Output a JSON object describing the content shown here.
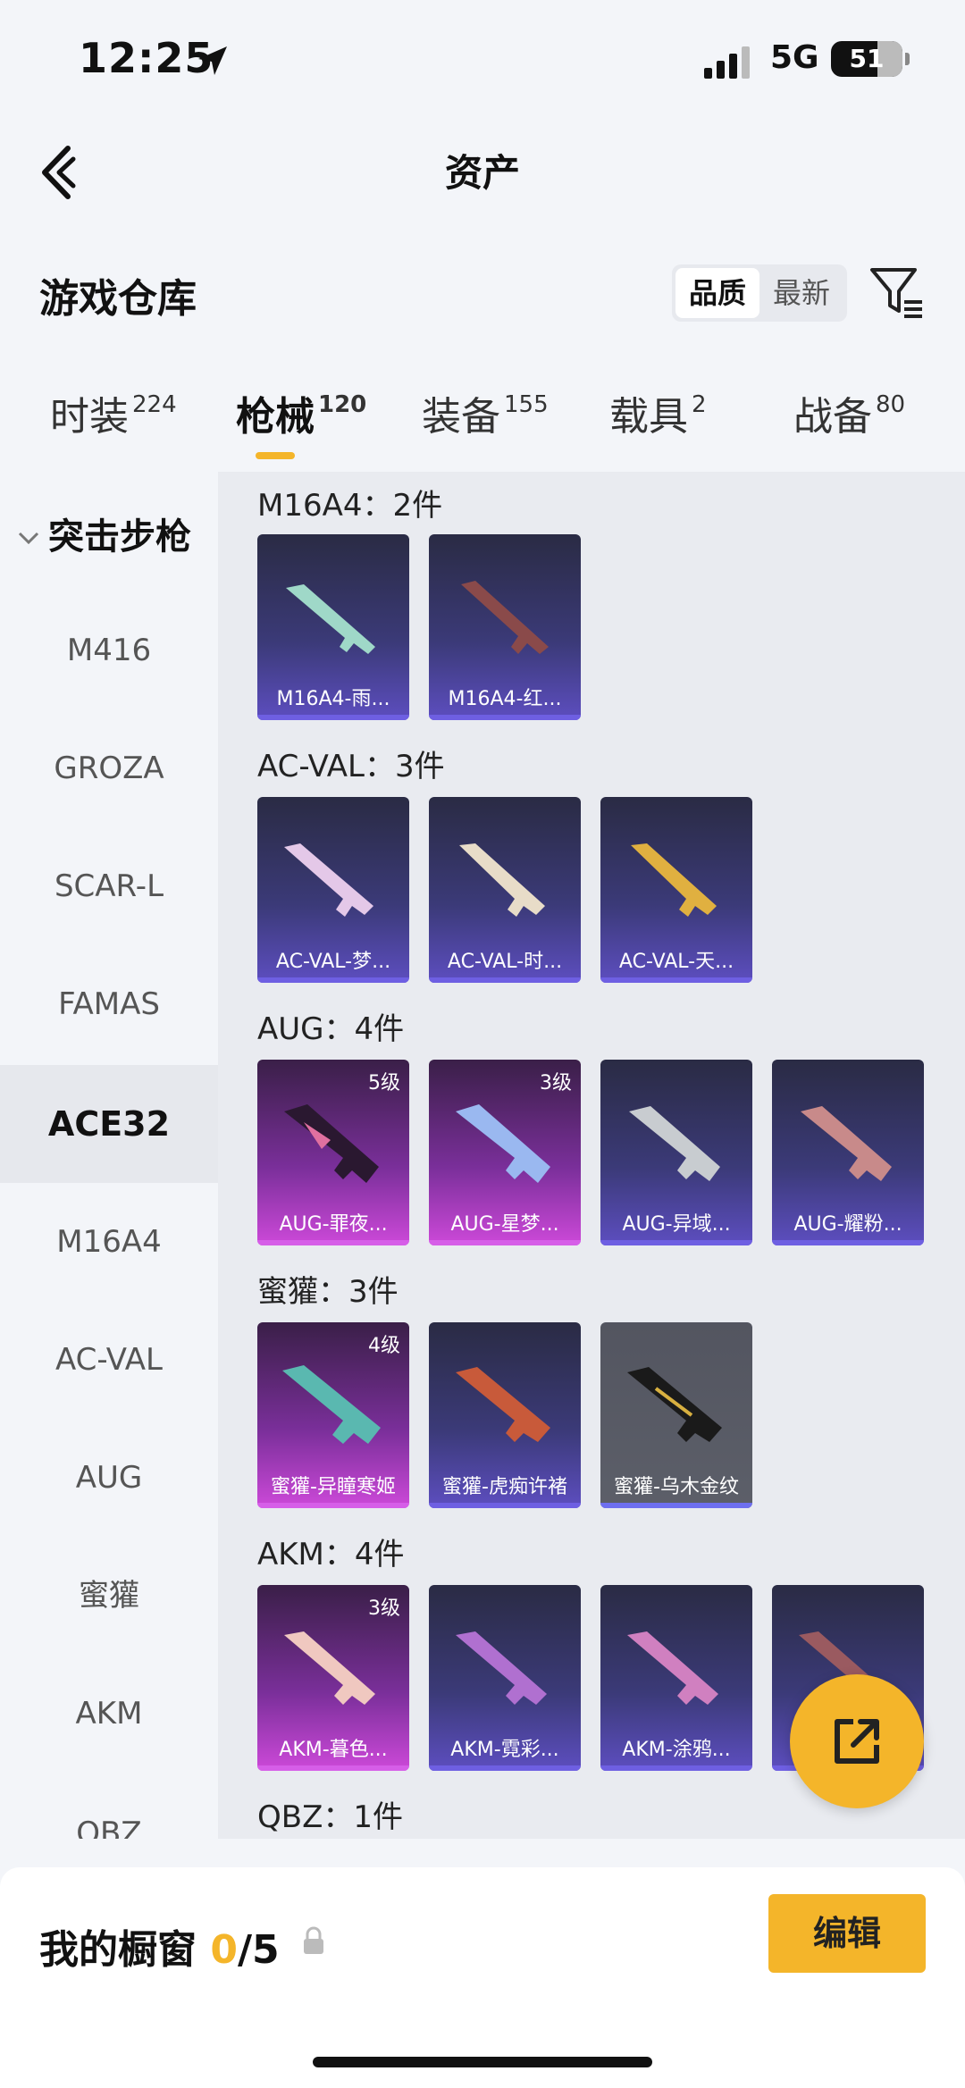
{
  "status": {
    "time": "12:25",
    "network": "5G",
    "battery": "51"
  },
  "nav": {
    "title": "资产"
  },
  "section": {
    "title": "游戏仓库",
    "sort_options": [
      "品质",
      "最新"
    ]
  },
  "tabs": [
    {
      "label": "时装",
      "count": "224"
    },
    {
      "label": "枪械",
      "count": "120"
    },
    {
      "label": "装备",
      "count": "155"
    },
    {
      "label": "载具",
      "count": "2"
    },
    {
      "label": "战备",
      "count": "80"
    }
  ],
  "sidebar": {
    "group": "突击步枪",
    "items": [
      "M416",
      "GROZA",
      "SCAR-L",
      "FAMAS",
      "ACE32",
      "M16A4",
      "AC-VAL",
      "AUG",
      "蜜獾",
      "AKM",
      "QBZ"
    ]
  },
  "groups": [
    {
      "label": "M16A4：2件",
      "cards": [
        {
          "name": "M16A4-雨...",
          "level": ""
        },
        {
          "name": "M16A4-红...",
          "level": ""
        }
      ]
    },
    {
      "label": "AC-VAL：3件",
      "cards": [
        {
          "name": "AC-VAL-梦...",
          "level": ""
        },
        {
          "name": "AC-VAL-时...",
          "level": ""
        },
        {
          "name": "AC-VAL-天...",
          "level": ""
        }
      ]
    },
    {
      "label": "AUG：4件",
      "cards": [
        {
          "name": "AUG-罪夜...",
          "level": "5级"
        },
        {
          "name": "AUG-星梦...",
          "level": "3级"
        },
        {
          "name": "AUG-异域...",
          "level": ""
        },
        {
          "name": "AUG-耀粉...",
          "level": ""
        }
      ]
    },
    {
      "label": "蜜獾：3件",
      "cards": [
        {
          "name": "蜜獾-异瞳寒姬",
          "level": "4级"
        },
        {
          "name": "蜜獾-虎痴许褚",
          "level": ""
        },
        {
          "name": "蜜獾-乌木金纹",
          "level": ""
        }
      ]
    },
    {
      "label": "AKM：4件",
      "cards": [
        {
          "name": "AKM-暮色...",
          "level": "3级"
        },
        {
          "name": "AKM-霓彩...",
          "level": ""
        },
        {
          "name": "AKM-涂鸦...",
          "level": ""
        },
        {
          "name": "",
          "level": ""
        }
      ]
    },
    {
      "label": "QBZ：1件",
      "cards": []
    }
  ],
  "showcase": {
    "label": "我的橱窗",
    "count": "0",
    "total": "/5",
    "edit": "编辑"
  },
  "colors": {
    "accent": "#f4b52a",
    "card_purple": "#5d4ec0",
    "card_pink": "#cd49d9",
    "card_gray": "#5c5f69"
  }
}
